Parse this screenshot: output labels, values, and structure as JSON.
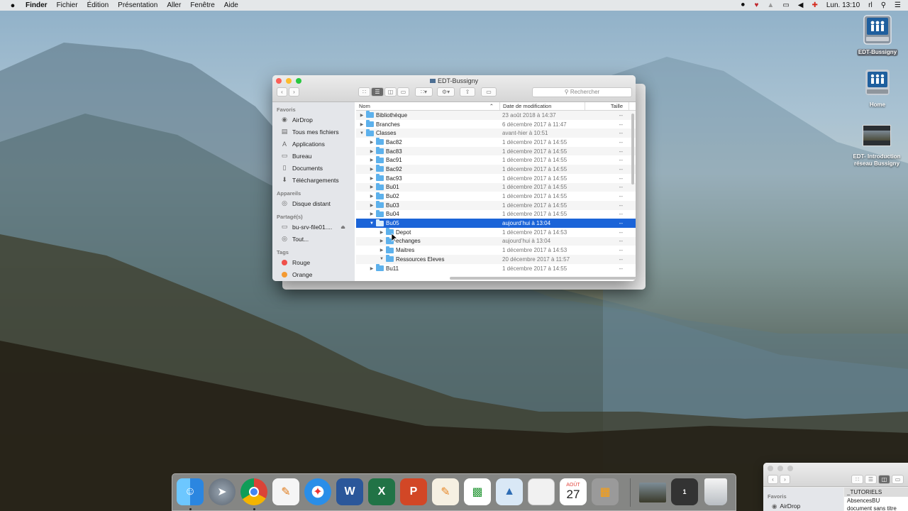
{
  "menubar": {
    "apple": "",
    "app": "Finder",
    "menus": [
      "Fichier",
      "Édition",
      "Présentation",
      "Aller",
      "Fenêtre",
      "Aide"
    ],
    "clock": "Lun. 13:10",
    "user": "rl"
  },
  "desktop": {
    "icons": [
      {
        "label": "EDT-Bussigny"
      },
      {
        "label": "Home"
      },
      {
        "label": "EDT- Introduction réseau Bussigny"
      }
    ]
  },
  "finder": {
    "title": "EDT-Bussigny",
    "search_placeholder": "Rechercher",
    "sidebar": {
      "favoris_header": "Favoris",
      "favoris": [
        "AirDrop",
        "Tous mes fichiers",
        "Applications",
        "Bureau",
        "Documents",
        "Téléchargements"
      ],
      "appareils_header": "Appareils",
      "appareils": [
        "Disque distant"
      ],
      "partages_header": "Partagé(s)",
      "partages": [
        "bu-srv-file01....",
        "Tout..."
      ],
      "tags_header": "Tags",
      "tags": [
        {
          "label": "Rouge",
          "color": "#f0504a"
        },
        {
          "label": "Orange",
          "color": "#f49a32"
        }
      ]
    },
    "columns": {
      "name": "Nom",
      "date": "Date de modification",
      "size": "Taille"
    },
    "rows": [
      {
        "name": "Bibliothèque",
        "date": "23 août 2018 à 14:37",
        "size": "--",
        "level": 0,
        "open": false,
        "selected": false
      },
      {
        "name": "Branches",
        "date": "6 décembre 2017 à 11:47",
        "size": "--",
        "level": 0,
        "open": false,
        "selected": false
      },
      {
        "name": "Classes",
        "date": "avant-hier à 10:51",
        "size": "--",
        "level": 0,
        "open": true,
        "selected": false
      },
      {
        "name": "Bac82",
        "date": "1 décembre 2017 à 14:55",
        "size": "--",
        "level": 1,
        "open": false,
        "selected": false
      },
      {
        "name": "Bac83",
        "date": "1 décembre 2017 à 14:55",
        "size": "--",
        "level": 1,
        "open": false,
        "selected": false
      },
      {
        "name": "Bac91",
        "date": "1 décembre 2017 à 14:55",
        "size": "--",
        "level": 1,
        "open": false,
        "selected": false
      },
      {
        "name": "Bac92",
        "date": "1 décembre 2017 à 14:55",
        "size": "--",
        "level": 1,
        "open": false,
        "selected": false
      },
      {
        "name": "Bac93",
        "date": "1 décembre 2017 à 14:55",
        "size": "--",
        "level": 1,
        "open": false,
        "selected": false
      },
      {
        "name": "Bu01",
        "date": "1 décembre 2017 à 14:55",
        "size": "--",
        "level": 1,
        "open": false,
        "selected": false
      },
      {
        "name": "Bu02",
        "date": "1 décembre 2017 à 14:55",
        "size": "--",
        "level": 1,
        "open": false,
        "selected": false
      },
      {
        "name": "Bu03",
        "date": "1 décembre 2017 à 14:55",
        "size": "--",
        "level": 1,
        "open": false,
        "selected": false
      },
      {
        "name": "Bu04",
        "date": "1 décembre 2017 à 14:55",
        "size": "--",
        "level": 1,
        "open": false,
        "selected": false
      },
      {
        "name": "Bu05",
        "date": "aujourd’hui à 13:04",
        "size": "--",
        "level": 1,
        "open": true,
        "selected": true
      },
      {
        "name": "Depot",
        "date": "1 décembre 2017 à 14:53",
        "size": "--",
        "level": 2,
        "open": false,
        "selected": false
      },
      {
        "name": "echanges",
        "date": "aujourd’hui à 13:04",
        "size": "--",
        "level": 2,
        "open": false,
        "selected": false
      },
      {
        "name": "Maitres",
        "date": "1 décembre 2017 à 14:53",
        "size": "--",
        "level": 2,
        "open": false,
        "selected": false
      },
      {
        "name": "Ressources Eleves",
        "date": "20 décembre 2017 à 11:57",
        "size": "--",
        "level": 2,
        "open": true,
        "selected": false
      },
      {
        "name": "Bu11",
        "date": "1 décembre 2017 à 14:55",
        "size": "--",
        "level": 1,
        "open": false,
        "selected": false
      }
    ]
  },
  "dock": {
    "calendar_month": "AOÛT",
    "calendar_day": "27",
    "apps": [
      "Finder",
      "Launchpad",
      "Chrome",
      "Notes",
      "Safari",
      "Word",
      "Excel",
      "PowerPoint",
      "Pages",
      "Numbers",
      "Keynote",
      "Fichier",
      "Calendrier",
      "Calculette",
      "Image",
      "Fenêtres",
      "Corbeille"
    ]
  },
  "mini_window": {
    "favoris_header": "Favoris",
    "airdrop": "AirDrop",
    "items": [
      "_TUTORIELS",
      "AbsencesBU",
      "document sans titre"
    ]
  }
}
